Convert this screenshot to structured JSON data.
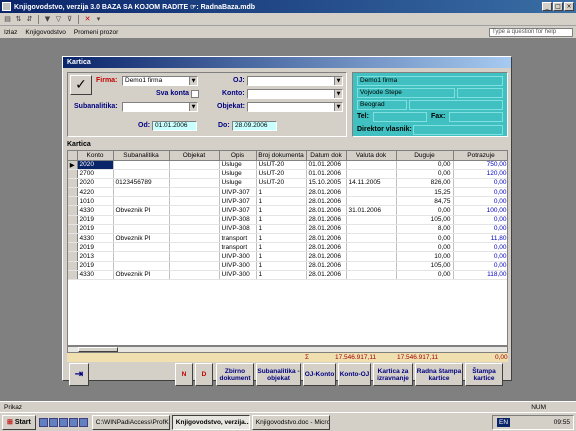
{
  "window": {
    "title": "Knjigovodstvo, verzija 3.0    BAZA SA KOJOM RADITE ☞: RadnaBaza.mdb"
  },
  "toolbar": {
    "icons": [
      "print-icon",
      "sort-icon",
      "filter-icon",
      "filter-apply-icon",
      "filter-remove-icon",
      "delete-record-icon"
    ]
  },
  "menu": {
    "items": [
      "Izlaz",
      "Knjigovodstvo",
      "Promeni prozor"
    ],
    "help_placeholder": "Type a question for help"
  },
  "kartica_window": {
    "title": "Kartica",
    "filters": {
      "firma_label": "Firma:",
      "firma_value": "Demo1 firma",
      "oj_label": "OJ:",
      "oj_value": "",
      "sva_konta_label": "Sva konta",
      "konto_label": "Konto:",
      "konto_value": "",
      "subanalitika_label": "Subanalitika:",
      "subanalitika_value": "",
      "objekat_label": "Objekat:",
      "objekat_value": "",
      "od_label": "Od:",
      "od_value": "01.01.2006",
      "do_label": "Do:",
      "do_value": "28.09.2006"
    },
    "company": {
      "name": "Demo1 firma",
      "address": "Vojvode Stepe",
      "city": "Beograd",
      "tel_label": "Tel:",
      "tel_value": "",
      "fax_label": "Fax:",
      "fax_value": "",
      "director_label": "Direktor vlasnik:",
      "director_value": ""
    },
    "grid_label": "Kartica",
    "columns": [
      "Konto",
      "Subanalitika",
      "Objekat",
      "Opis",
      "Broj dokumenta",
      "Datum dok",
      "Valuta dok",
      "Duguje",
      "Potrazuje"
    ],
    "rows": [
      [
        "2020",
        "",
        "",
        "Usluge",
        "UsUT-20",
        "01.01.2006",
        "",
        "0,00",
        "750,00"
      ],
      [
        "2700",
        "",
        "",
        "Usluge",
        "UsUT-20",
        "01.01.2006",
        "",
        "0,00",
        "120,00"
      ],
      [
        "2020",
        "0123456789",
        "",
        "Usluge",
        "UsUT-20",
        "15.10.2005",
        "14.11.2005",
        "826,00",
        "0,00"
      ],
      [
        "4220",
        "",
        "",
        "UIVP-307",
        "1",
        "28.01.2006",
        "",
        "15,25",
        "0,00"
      ],
      [
        "1010",
        "",
        "",
        "UIVP-307",
        "1",
        "28.01.2006",
        "",
        "84,75",
        "0,00"
      ],
      [
        "4330",
        "Obveznik PI",
        "",
        "UIVP-307",
        "1",
        "28.01.2006",
        "31.01.2006",
        "0,00",
        "100,00"
      ],
      [
        "2019",
        "",
        "",
        "UIVP-308",
        "1",
        "28.01.2006",
        "",
        "105,00",
        "0,00"
      ],
      [
        "2019",
        "",
        "",
        "UIVP-308",
        "1",
        "28.01.2006",
        "",
        "8,00",
        "0,00"
      ],
      [
        "4330",
        "Obveznik PI",
        "",
        "transport",
        "1",
        "28.01.2006",
        "",
        "0,00",
        "11,80"
      ],
      [
        "2019",
        "",
        "",
        "transport",
        "1",
        "28.01.2006",
        "",
        "0,00",
        "0,00"
      ],
      [
        "2013",
        "",
        "",
        "UIVP-300",
        "1",
        "28.01.2006",
        "",
        "10,00",
        "0,00"
      ],
      [
        "2019",
        "",
        "",
        "UIVP-300",
        "1",
        "28.01.2006",
        "",
        "105,00",
        "0,00"
      ],
      [
        "4330",
        "Obveznik PI",
        "",
        "UIVP-300",
        "1",
        "28.01.2006",
        "",
        "0,00",
        "118,00"
      ]
    ],
    "totals": {
      "sigma": "Σ",
      "duguje_total": "17.546.917,11",
      "potrazuje_total": "17.546.917,11",
      "saldo": "0,00"
    },
    "buttons": {
      "n": "N",
      "d": "D",
      "zbirno": "Zbirno dokument",
      "subanalitika_objekat": "Subanalitika -objekat",
      "oj_konto": "OJ-Konto",
      "konto_oj": "Konto-OJ",
      "kartica_izravnanje": "Kartica za izravnanje",
      "radna_stampa": "Radna štampa kartice",
      "stampa_kartice": "Štampa kartice"
    }
  },
  "status": {
    "text": "Prikaz",
    "mode": "NUM"
  },
  "taskbar": {
    "start_label": "Start",
    "tasks": [
      "C:\\WINPadiAccess\\ProfK...",
      "Knjigovodstvo, verzija...",
      "Knjigovodstvo.doc - Micro..."
    ],
    "active_task": 1,
    "lang": "EN",
    "clock": "09:55"
  }
}
